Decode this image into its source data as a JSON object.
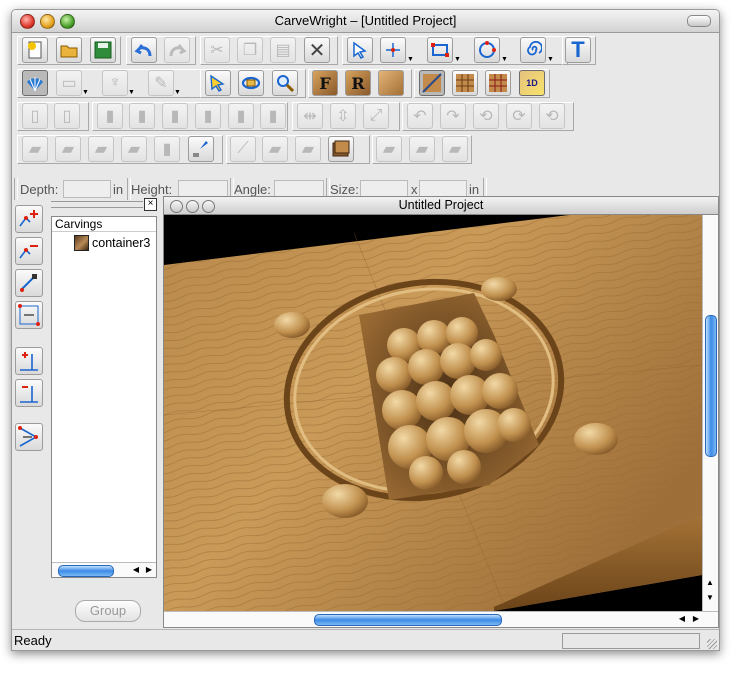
{
  "window": {
    "title": "CarveWright – [Untitled Project]"
  },
  "toolbar_rows": {
    "row1": [
      "new-project",
      "open-file",
      "save",
      "undo",
      "redo",
      "cut",
      "copy",
      "paste",
      "delete",
      "select-arrow",
      "node-edit",
      "draw-rectangle",
      "draw-circle",
      "draw-spiral",
      "text-tool"
    ],
    "row2": [
      "carving-shell",
      "carving-layer",
      "carving-dish",
      "feather-pen",
      "select-patterns",
      "rotate-view",
      "zoom",
      "front-view",
      "right-view",
      "texture-view",
      "wood-board",
      "grid-view",
      "pattern-grid",
      "pattern-1d"
    ]
  },
  "text_tool_label": "T",
  "front_label": "F",
  "right_label": "R",
  "pattern_label": "1D",
  "fields": {
    "depth_label": "Depth:",
    "depth_unit": "in",
    "height_label": "Height:",
    "angle_label": "Angle:",
    "size_label": "Size:",
    "size_sep": "x",
    "size_unit": "in"
  },
  "panel": {
    "tree_header": "Carvings",
    "items": [
      {
        "label": "container3"
      }
    ],
    "group_button": "Group",
    "close_glyph": "×"
  },
  "document": {
    "title": "Untitled Project"
  },
  "status": {
    "text": "Ready"
  },
  "colors": {
    "accent_blue": "#3b8be6",
    "wood_light": "#c4954f",
    "wood_dark": "#7e5426"
  }
}
